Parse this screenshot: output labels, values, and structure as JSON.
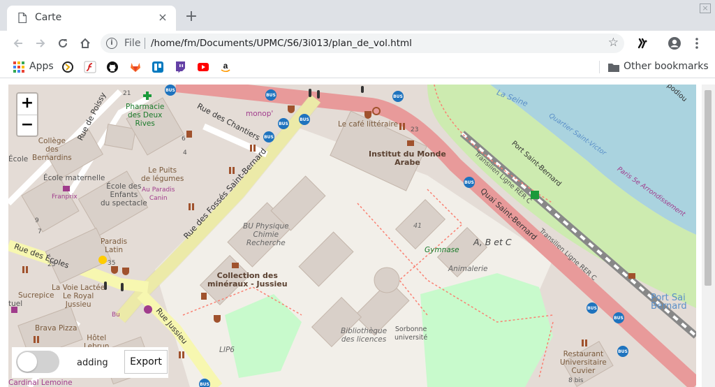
{
  "tab": {
    "title": "Carte",
    "close_glyph": "×",
    "new_tab_glyph": "+"
  },
  "window": {
    "close_glyph": "×"
  },
  "toolbar": {
    "info_glyph": "i",
    "scheme": "File",
    "url": "/home/fm/Documents/UPMC/S6/3i013/plan_de_vol.html",
    "star_glyph": "☆"
  },
  "bookmarks": {
    "apps_label": "Apps",
    "other_label": "Other bookmarks"
  },
  "map": {
    "zoom_in": "+",
    "zoom_out": "−",
    "labels": {
      "pharmacie": "Pharmacie\ndes Deux\nRives",
      "rue_chantiers": "Rue des Chantiers",
      "monop": "monop'",
      "cafe_litteraire": "Le café littéraire",
      "institut": "Institut du Monde\nArabe",
      "college": "Collège\ndes\nBernardins",
      "ecole": "École",
      "ecole_maternelle": "École maternelle",
      "ecole_enfants": "École des\nEnfants\ndu spectacle",
      "puits": "Le Puits\nde légumes",
      "paradis_canin": "Au Paradis\nCanin",
      "franprix1": "Franprix",
      "franprix2": "Franprix",
      "rue_fosses": "Rue des Fossés Saint-Bernard",
      "rue_poissy": "Rue de Poissy",
      "bu_physique": "BU Physique\nChimie\nRecherche",
      "paradis_latin": "Paradis\nLatin",
      "rue_ecoles": "Rue des Écoles",
      "collection": "Collection des\nminéraux - Jussieu",
      "voie_lactee": "La Voie Lactée\nLe Royal\nJussieu",
      "sucrepice": "Sucrepice",
      "tuel": "tuel",
      "bu": "Bu",
      "brava_pizza": "Brava Pizza",
      "hotel_lebrun": "Hôtel\nLebrun",
      "rue_jussieu": "Rue Jussieu",
      "cardinal": "Cardinal Lemoine",
      "lip6": "LIP6",
      "bibliotheque": "Bibliothèque\ndes licences",
      "sorbonne": "Sorbonne\nuniversité",
      "gymnase": "Gymnase",
      "abc": "A, B et C",
      "animalerie": "Animalerie",
      "num41": "41",
      "quai_st_bernard": "Quai Saint-Bernard",
      "la_seine": "La Seine",
      "quartier_st_victor": "Quartier Saint-Victor",
      "paris_5e": "Paris 5e Arrondissement",
      "port_st_bernard": "Port Saint-Bernard",
      "transilien1": "Transilien Ligne RER C",
      "transilien2": "Transilien Ligne RER C",
      "port_st_bernard2": "Port Sai\nBernard",
      "restaurant": "Restaurant\nUniversitaire\nCuvier",
      "num21": "21",
      "num23": "23",
      "num25": "25",
      "num35": "35",
      "num9": "9",
      "num7": "7",
      "num4": "4",
      "num6": "6",
      "num8bis": "8 bis",
      "podiou": "podiou"
    }
  },
  "controls": {
    "toggle_state": "off",
    "adding_label": "adding",
    "export_label": "Export"
  },
  "colors": {
    "road_major": "#e89a9a",
    "road_secondary": "#f7f7b0",
    "building": "#d9d0c9",
    "water": "#aad3df",
    "park": "#cdebb0",
    "campus": "#f2efe9"
  }
}
